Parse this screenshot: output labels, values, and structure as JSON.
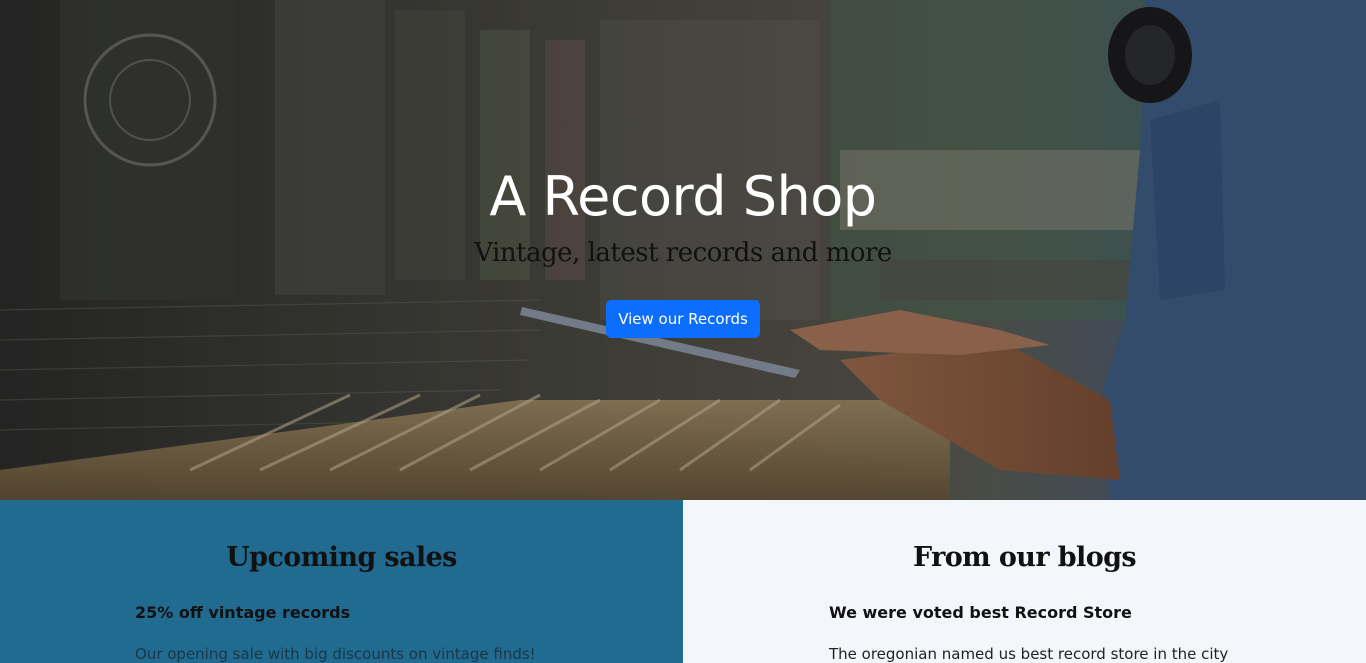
{
  "hero": {
    "title": "A Record Shop",
    "subtitle": "Vintage, latest records and more",
    "cta_label": "View our Records",
    "accent_color": "#0d6efd"
  },
  "sales": {
    "heading": "Upcoming sales",
    "item_title": "25% off vintage records",
    "item_text": "Our opening sale with big discounts on vintage finds!",
    "background_color": "#216a90"
  },
  "blogs": {
    "heading": "From our blogs",
    "item_title": "We were voted best Record Store",
    "item_text": "The oregonian named us best record store in the city",
    "background_color": "#f3f6fb"
  }
}
